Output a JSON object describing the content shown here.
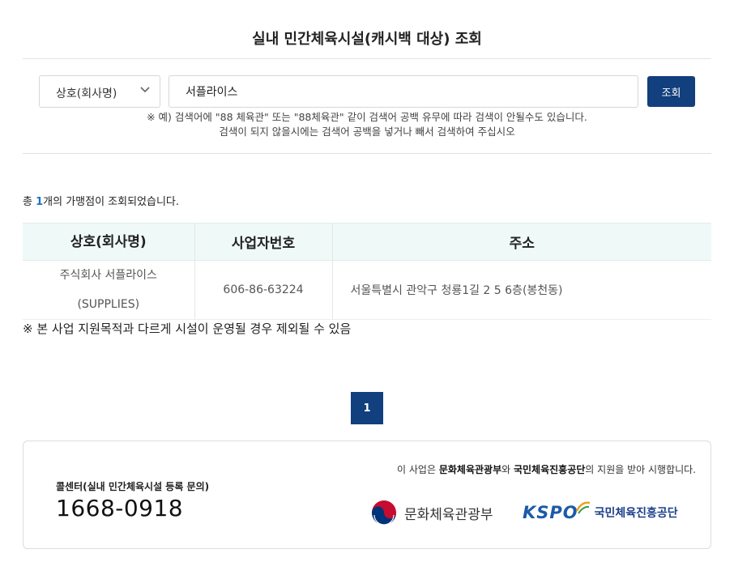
{
  "header": {
    "title": "실내 민간체육시설(캐시백 대상) 조회"
  },
  "search": {
    "select_value": "상호(회사명)",
    "input_value": "서플라이스",
    "button_label": "조회",
    "notice_line1": "※ 예) 검색어에 \"88 체육관\" 또는 \"88체육관\" 같이 검색어 공백 유무에 따라 검색이 안될수도 있습니다.",
    "notice_line2": "검색이 되지 않을시에는 검색어 공백을 넣거나 빼서 검색하여 주십시오"
  },
  "results": {
    "count_prefix": "총 ",
    "count": "1",
    "count_suffix": "개의 가맹점이 조회되었습니다.",
    "columns": [
      "상호(회사명)",
      "사업자번호",
      "주소"
    ],
    "rows": [
      {
        "name_line1": "주식회사 서플라이스",
        "name_line2": "(SUPPLIES)",
        "business_number": "606-86-63224",
        "address": "서울특별시 관악구 청룡1길 2 5 6층(봉천동)"
      }
    ],
    "footnote": "※ 본 사업 지원목적과 다르게 시설이 운영될 경우 제외될 수 있음"
  },
  "pagination": {
    "current": "1"
  },
  "footer": {
    "callcenter_label": "콜센터(실내 민간체육시설 등록 문의)",
    "callcenter_number": "1668-0918",
    "support_prefix": "이 사업은 ",
    "support_org1": "문화체육관광부",
    "support_mid": "와 ",
    "support_org2": "국민체육진흥공단",
    "support_suffix": "의 지원을 받아 시행합니다.",
    "mcst_name": "문화체육관광부",
    "kspo_mark": "KSPO",
    "kspo_name": "국민체육진흥공단"
  },
  "colors": {
    "primary": "#123f7d",
    "accent": "#1a74c7",
    "table_header_bg": "#eff9f8"
  }
}
